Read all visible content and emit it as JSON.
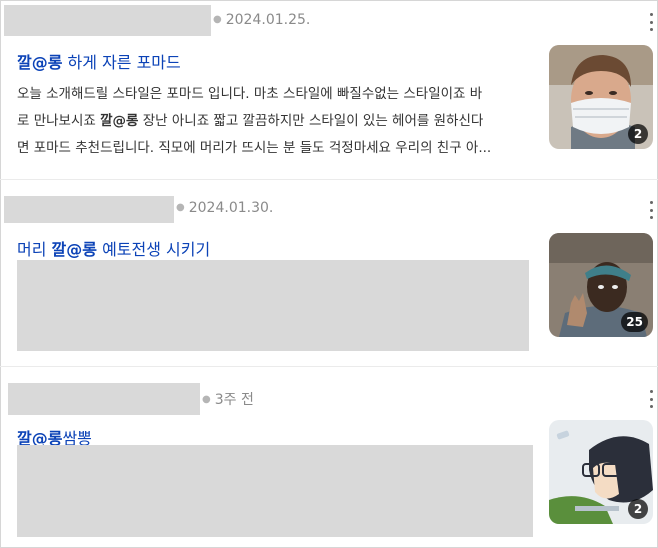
{
  "results": [
    {
      "date": "2024.01.25.",
      "title_parts": [
        "깔@롱",
        " 하게 자른 포마드"
      ],
      "snippet_lines": [
        [
          "오늘 소개해드릴 스타일은 포마드 입니다. 마초 스타일에 빠질수없는 스타일이죠 바",
          "",
          ""
        ],
        [
          "로 만나보시죠 ",
          "깔@롱",
          " 장난 아니죠 짧고 깔끔하지만 스타일이 있는 헤어를 원하신다"
        ],
        [
          "면 포마드 추천드립니다. 직모에 머리가 뜨시는 분 들도 걱정마세요 우리의 친구 아...",
          "",
          ""
        ]
      ],
      "thumb_count": "2",
      "thumb_icon": "man-with-mask-photo"
    },
    {
      "date": "2024.01.30.",
      "title_parts": [
        "머리 ",
        "깔@롱",
        " 예토전생 시키기"
      ],
      "thumb_count": "25",
      "thumb_icon": "man-waving-photo"
    },
    {
      "date": "3주 전",
      "title_parts": [
        "깔@롱",
        "쌈뽕"
      ],
      "thumb_count": "2",
      "thumb_icon": "anime-character-with-glasses"
    }
  ],
  "colors": {
    "title": "#0c43b7",
    "meta": "#8a8a8a",
    "redaction": "#d9d9d9"
  }
}
